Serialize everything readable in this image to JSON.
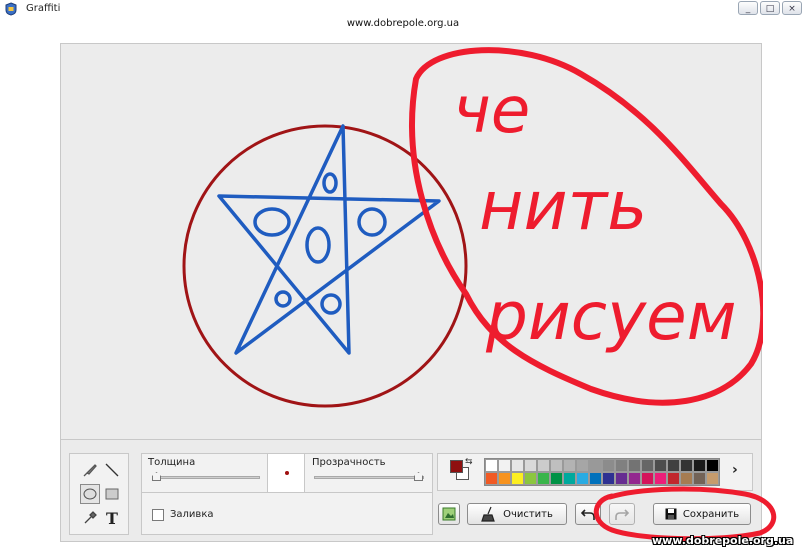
{
  "window": {
    "title": "Graffiti",
    "url": "www.dobrepole.org.ua"
  },
  "icons": {
    "app": "app-icon",
    "minimize": "minimize-icon",
    "maximize": "maximize-icon",
    "close": "close-icon",
    "brush": "brush-icon",
    "line": "line-icon",
    "ellipse": "ellipse-icon",
    "rectangle": "rectangle-icon",
    "eyedropper": "eyedropper-icon",
    "text": "text-tool-icon",
    "image": "image-icon",
    "clear": "broom-icon",
    "undo": "undo-icon",
    "redo": "redo-icon",
    "save": "floppy-icon"
  },
  "window_buttons": {
    "minimize": "_",
    "maximize": "□",
    "close": "×"
  },
  "canvas": {
    "handwriting_lines": [
      "че",
      "нить",
      "рисуем"
    ],
    "circle_color": "#a01416",
    "star_color": "#1f5cc0",
    "marker_color": "#ee1c2e"
  },
  "toolbar": {
    "thickness_label": "Толщина",
    "thickness_value": 0.0,
    "opacity_label": "Прозрачность",
    "opacity_value": 1.0,
    "fill_label": "Заливка",
    "fill_checked": false,
    "text_tool_glyph": "T",
    "palette_more": "›",
    "current_color": "#8f1010",
    "palette": [
      "#ffffff",
      "#f2f2f2",
      "#e6e6e6",
      "#d9d9d9",
      "#cccccc",
      "#bfbfbf",
      "#b3b3b3",
      "#a6a6a6",
      "#999999",
      "#8c8c8c",
      "#808080",
      "#737373",
      "#666666",
      "#4d4d4d",
      "#404040",
      "#333333",
      "#1a1a1a",
      "#000000",
      "#f15a24",
      "#f7931e",
      "#fcee21",
      "#8cc63f",
      "#39b54a",
      "#009245",
      "#00a99d",
      "#29abe2",
      "#0071bc",
      "#2e3192",
      "#662d91",
      "#93278f",
      "#d4145a",
      "#ed1e79",
      "#c1272d",
      "#a67c52",
      "#736357",
      "#c69c6d"
    ],
    "clear_label": "Очистить",
    "save_label": "Сохранить"
  },
  "watermark": "www.dobrepole.org.ua"
}
